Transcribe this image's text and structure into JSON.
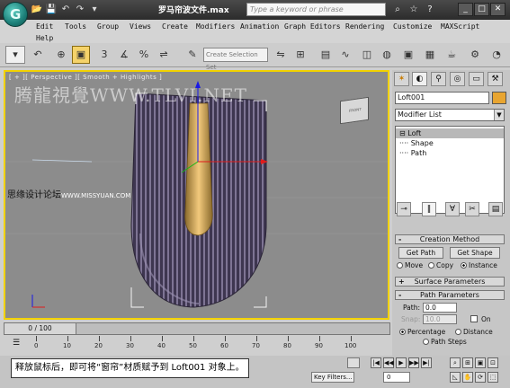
{
  "titlebar": {
    "app_logo_glyph": "G",
    "quick_access": [
      "📂",
      "💾",
      "↶",
      "↷",
      "▾"
    ],
    "title": "罗马帘波文件.max",
    "search_placeholder": "Type a keyword or phrase",
    "icons": [
      "binoculars-icon",
      "star-icon",
      "help-icon"
    ],
    "window_buttons": [
      "_",
      "□",
      "✕"
    ]
  },
  "menu": {
    "items": [
      "Edit",
      "Tools",
      "Group",
      "Views",
      "Create",
      "Modifiers",
      "Animation",
      "Graph Editors",
      "Rendering",
      "Customize",
      "MAXScript",
      "Help"
    ]
  },
  "toolbar": {
    "selection_set_placeholder": "Create Selection Set",
    "tools": [
      "↶",
      "⊕",
      "▣",
      "3",
      "∡",
      "%",
      "⇌",
      "✎"
    ]
  },
  "viewport": {
    "label": "[ + ][ Perspective ][ Smooth + Highlights ]",
    "watermark": "腾龍視覺WWW.TLVI.NET",
    "watermark2": "思缘设计论坛",
    "watermark2_small": "WWW.MISSYUAN.COM",
    "viewcube_label": "FRONT"
  },
  "command_panel": {
    "tabs": [
      "✶",
      "◐",
      "⚲",
      "◎",
      "▭",
      "⚒"
    ],
    "object_name": "Loft001",
    "modifier_list": "Modifier List",
    "stack": [
      {
        "label": "⊟ Loft",
        "selected": true
      },
      {
        "label": "  ···· Shape",
        "selected": false
      },
      {
        "label": "  ···· Path",
        "selected": false
      }
    ],
    "stack_buttons": [
      "⊸",
      "‖",
      "∀",
      "✂",
      "▤"
    ],
    "creation_method": {
      "title": "Creation Method",
      "get_path": "Get Path",
      "get_shape": "Get Shape",
      "options": [
        {
          "label": "Move",
          "on": false
        },
        {
          "label": "Copy",
          "on": false
        },
        {
          "label": "Instance",
          "on": true
        }
      ]
    },
    "surface_parameters": {
      "title": "Surface Parameters"
    },
    "path_parameters": {
      "title": "Path Parameters",
      "path_label": "Path:",
      "path_value": "0.0",
      "snap_label": "Snap:",
      "snap_value": "10.0",
      "on_label": "On",
      "options": [
        {
          "label": "Percentage",
          "on": true
        },
        {
          "label": "Distance",
          "on": false
        },
        {
          "label": "Path Steps",
          "on": false
        }
      ]
    }
  },
  "timeline": {
    "slider_label": "0 / 100",
    "ticks": [
      "0",
      "10",
      "20",
      "30",
      "40",
      "50",
      "60",
      "70",
      "80",
      "90",
      "100"
    ]
  },
  "status": {
    "caption": "释放鼠标后，即可将“窗帘”材质赋予到 Loft001 对象上。",
    "key_filters": "Key Filters...",
    "frame_value": "0",
    "playback": [
      "|◀",
      "◀◀",
      "▶",
      "▶▶",
      "▶|"
    ]
  }
}
